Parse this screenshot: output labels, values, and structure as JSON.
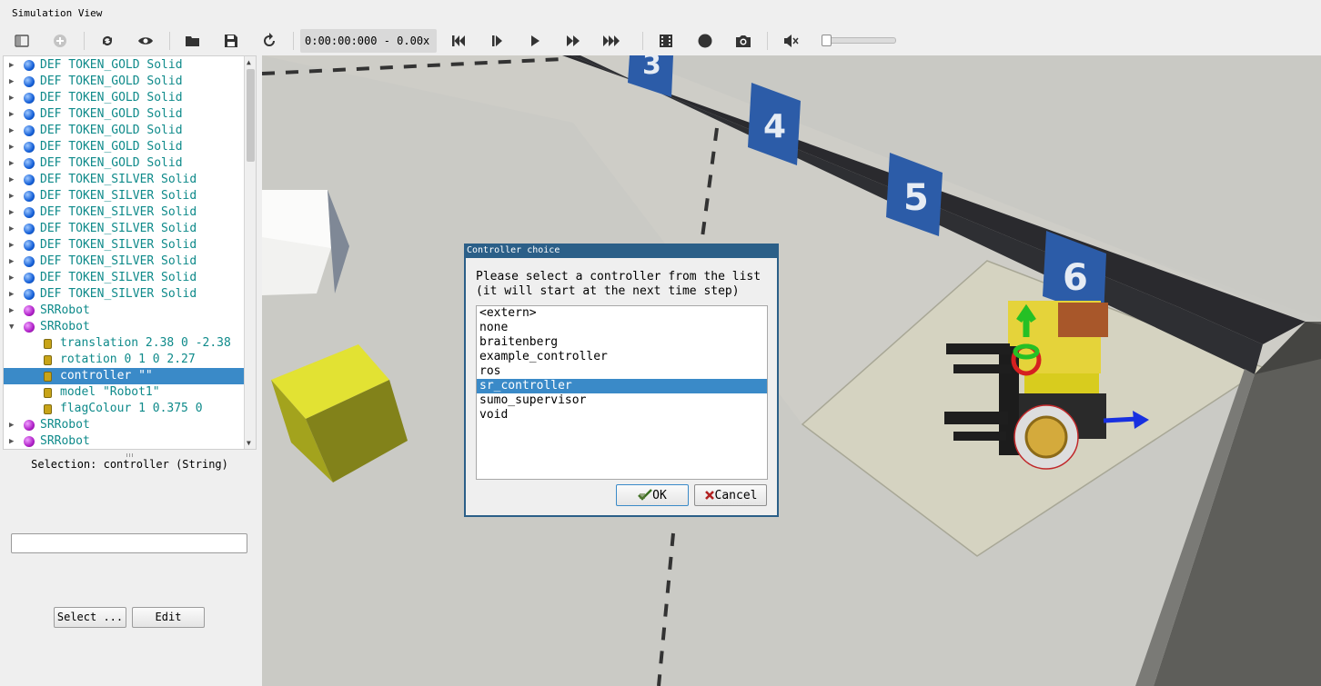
{
  "window": {
    "title": "Simulation View"
  },
  "toolbar": {
    "time": "0:00:00:000 -  0.00x",
    "buttons": [
      "toggle-scene-tree-icon",
      "add-node-icon",
      "reload-icon",
      "view-icon",
      "open-world-icon",
      "save-world-icon",
      "reset-world-icon",
      "step-back-icon",
      "step-icon",
      "run-icon",
      "fast-icon",
      "fastest-icon",
      "record-movie-icon",
      "record-animation-icon",
      "screenshot-icon",
      "mute-icon"
    ],
    "volume": 0
  },
  "scene_tree": {
    "items": [
      {
        "label": "DEF TOKEN_GOLD Solid",
        "icon": "solid-blue"
      },
      {
        "label": "DEF TOKEN_GOLD Solid",
        "icon": "solid-blue"
      },
      {
        "label": "DEF TOKEN_GOLD Solid",
        "icon": "solid-blue"
      },
      {
        "label": "DEF TOKEN_GOLD Solid",
        "icon": "solid-blue"
      },
      {
        "label": "DEF TOKEN_GOLD Solid",
        "icon": "solid-blue"
      },
      {
        "label": "DEF TOKEN_GOLD Solid",
        "icon": "solid-blue"
      },
      {
        "label": "DEF TOKEN_GOLD Solid",
        "icon": "solid-blue"
      },
      {
        "label": "DEF TOKEN_SILVER Solid",
        "icon": "solid-blue"
      },
      {
        "label": "DEF TOKEN_SILVER Solid",
        "icon": "solid-blue"
      },
      {
        "label": "DEF TOKEN_SILVER Solid",
        "icon": "solid-blue"
      },
      {
        "label": "DEF TOKEN_SILVER Solid",
        "icon": "solid-blue"
      },
      {
        "label": "DEF TOKEN_SILVER Solid",
        "icon": "solid-blue"
      },
      {
        "label": "DEF TOKEN_SILVER Solid",
        "icon": "solid-blue"
      },
      {
        "label": "DEF TOKEN_SILVER Solid",
        "icon": "solid-blue"
      },
      {
        "label": "DEF TOKEN_SILVER Solid",
        "icon": "solid-blue"
      },
      {
        "label": "SRRobot",
        "icon": "robot-purple"
      },
      {
        "label": "SRRobot",
        "icon": "robot-purple",
        "expanded": true
      },
      {
        "label": "translation 2.38 0 -2.38",
        "icon": "field"
      },
      {
        "label": "rotation 0 1 0 2.27",
        "icon": "field"
      },
      {
        "label": "controller \"\"",
        "icon": "field",
        "selected": true
      },
      {
        "label": "model \"Robot1\"",
        "icon": "field"
      },
      {
        "label": "flagColour 1 0.375 0",
        "icon": "field"
      },
      {
        "label": "SRRobot",
        "icon": "robot-purple"
      },
      {
        "label": "SRRobot",
        "icon": "robot-purple"
      }
    ]
  },
  "field_editor": {
    "selection": "Selection: controller (String)",
    "value": "",
    "select_label": "Select ...",
    "edit_label": "Edit"
  },
  "viewport": {
    "wall_labels": [
      "3",
      "4",
      "5",
      "6"
    ]
  },
  "dialog": {
    "title": "Controller choice",
    "prompt": "Please select a controller from the list\n(it will start at the next time step)",
    "options": [
      "<extern>",
      "none",
      "braitenberg",
      "example_controller",
      "ros",
      "sr_controller",
      "sumo_supervisor",
      "void"
    ],
    "selected": "sr_controller",
    "ok_label": "OK",
    "cancel_label": "Cancel"
  }
}
